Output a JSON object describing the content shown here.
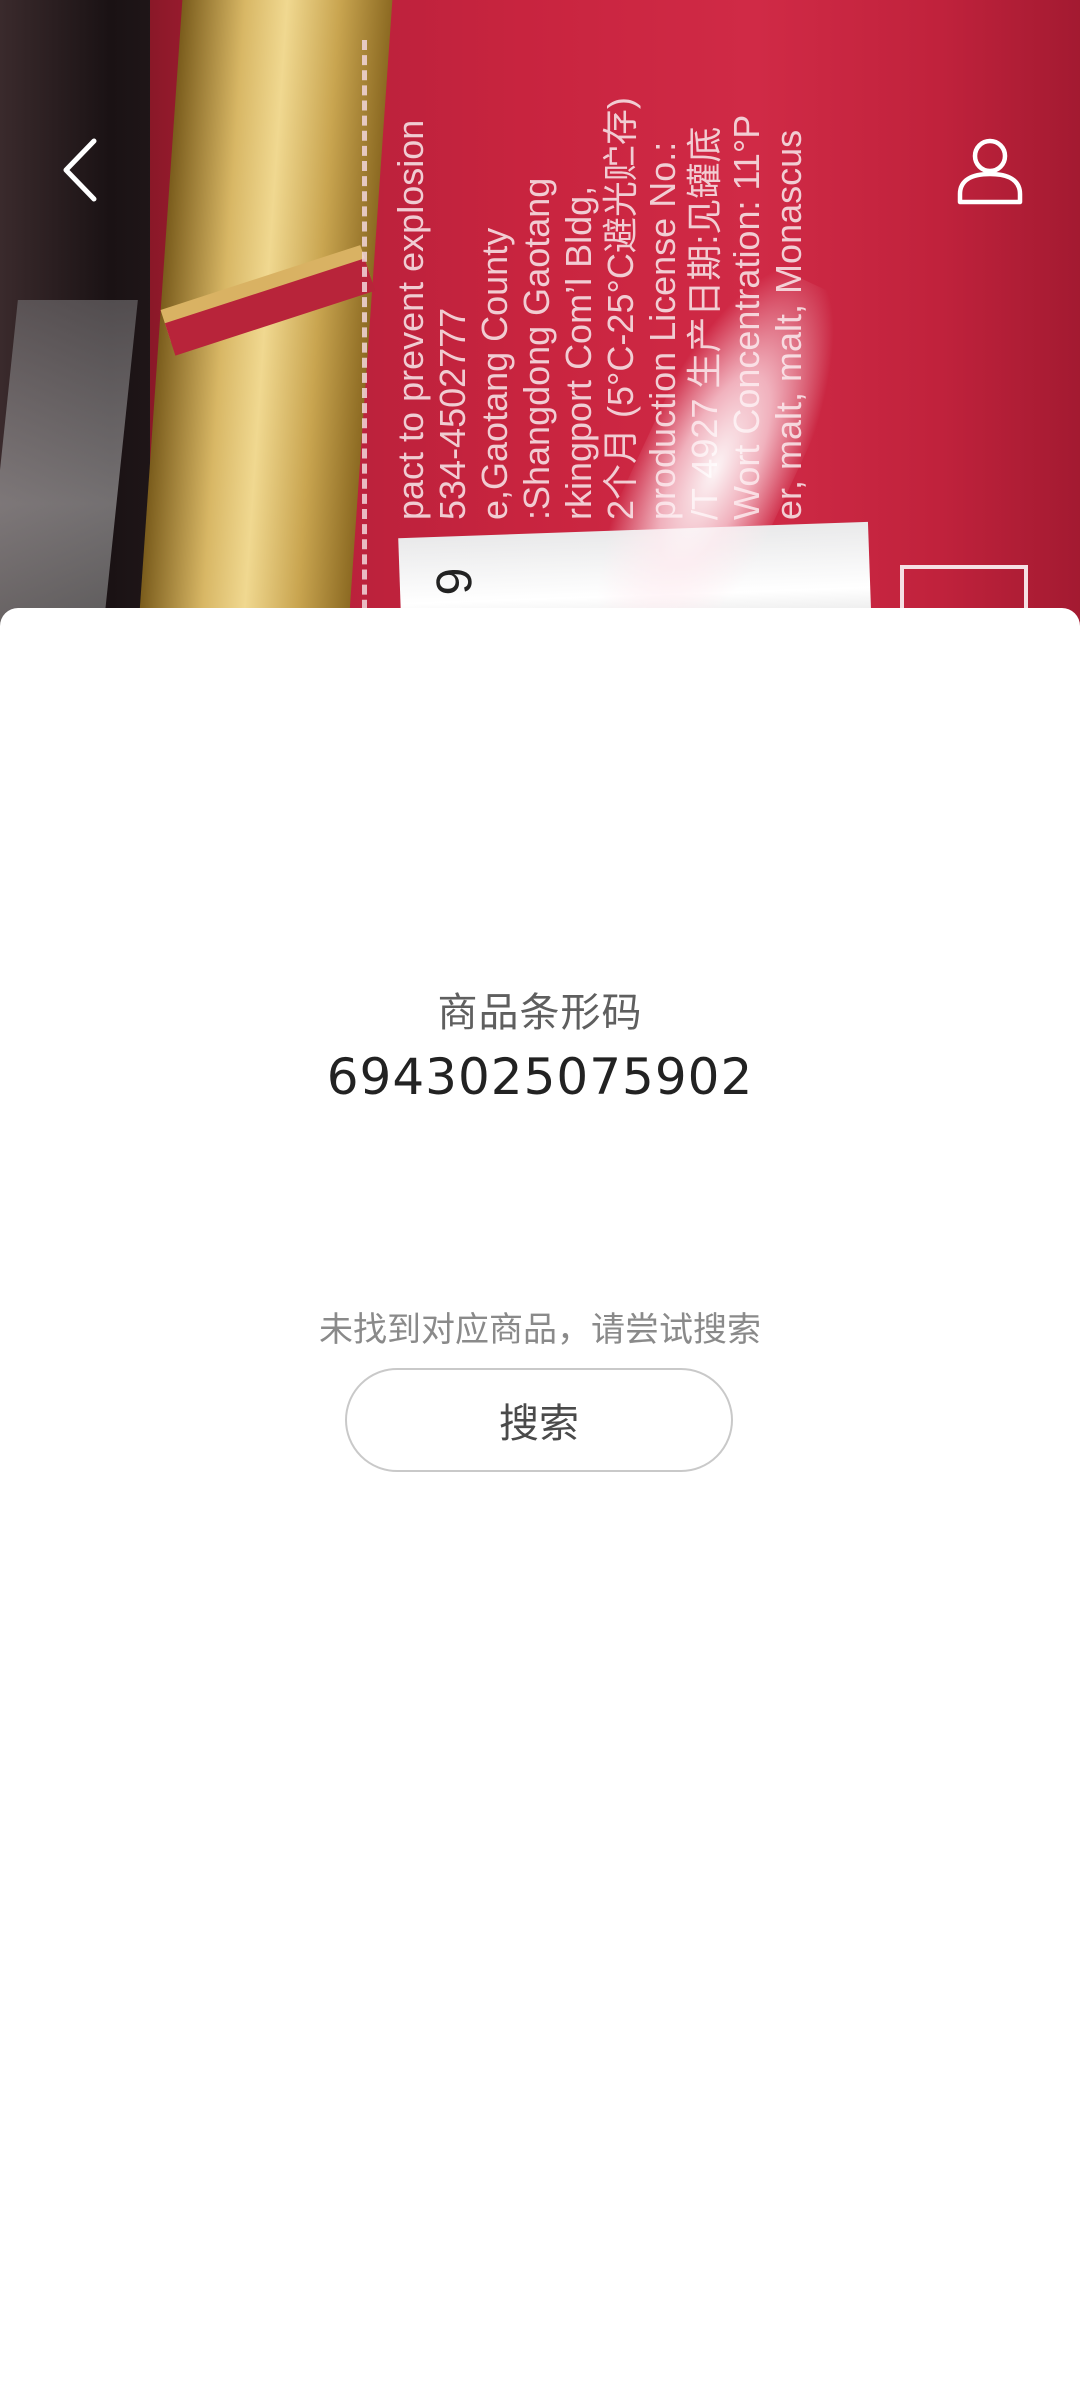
{
  "header": {
    "back_icon": "chevron-left-icon",
    "user_icon": "user-icon"
  },
  "camera": {
    "can_text_lines": [
      "er, malt, malt, Monascus",
      "Wort Concentration: 11°P",
      "/T 4927 生产日期:见罐底",
      "production License No.:",
      "2个月 (5°C-25°C避光贮存)",
      "rkingport Com’l Bldg,",
      ":Shangdong Gaotang",
      "e,Gaotang County",
      "534-4502777",
      "pact to prevent explosion"
    ],
    "label_digit": "6"
  },
  "result": {
    "barcode_title": "商品条形码",
    "barcode_value": "6943025075902",
    "not_found_message": "未找到对应商品，请尝试搜索",
    "search_label": "搜索"
  }
}
